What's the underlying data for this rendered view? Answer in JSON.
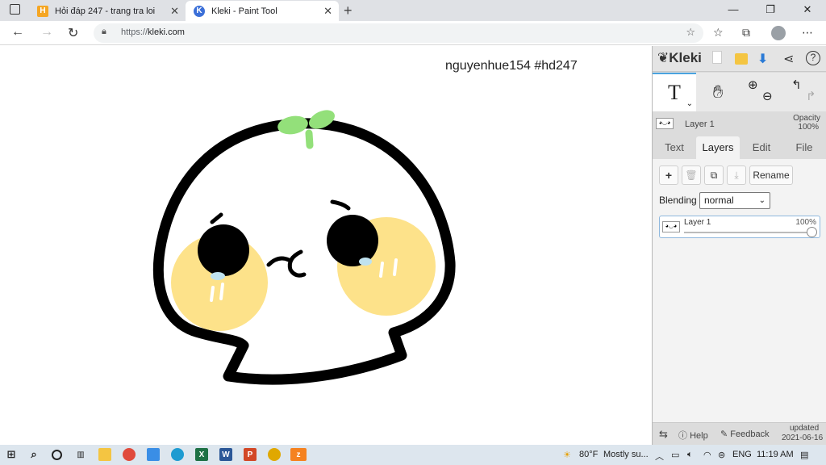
{
  "browser": {
    "tabs": [
      {
        "title": "Hỏi đáp 247 - trang tra loi",
        "favicon": "H"
      },
      {
        "title": "Kleki - Paint Tool",
        "favicon": "K"
      }
    ],
    "url_prefix": "https://",
    "url_host": "kleki.com"
  },
  "canvas": {
    "watermark": "nguyenhue154 #hd247"
  },
  "kleki": {
    "logo": "Kleki",
    "active_tool": "T",
    "layer_name": "Layer 1",
    "opacity_label": "Opacity",
    "opacity_value": "100%",
    "tabs": [
      "Text",
      "Layers",
      "Edit",
      "File"
    ],
    "active_tab": "Layers",
    "rename_label": "Rename",
    "blending_label": "Blending",
    "blending_value": "normal",
    "layer_item": {
      "name": "Layer 1",
      "opacity": "100%",
      "opacity_fraction": 1.0
    },
    "help_label": "Help",
    "feedback_label": "Feedback",
    "updated_label": "updated",
    "updated_date": "2021-06-16"
  },
  "taskbar": {
    "weather_temp": "80°F",
    "weather_text": "Mostly su...",
    "lang": "ENG",
    "time": "11:19 AM"
  }
}
